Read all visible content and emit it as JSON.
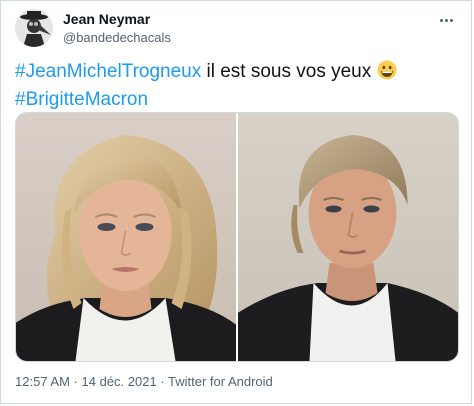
{
  "user": {
    "display_name": "Jean Neymar",
    "handle": "@bandedechacals"
  },
  "tweet": {
    "hashtag_1": "#JeanMichelTrogneux",
    "text_1": " il est sous vos yeux ",
    "emoji": "grinning-face-emoji",
    "hashtag_2": "#BrigitteMacron"
  },
  "media": {
    "photo_left": "photo-woman-blonde-hair",
    "photo_right": "photo-man-blond-hair"
  },
  "meta": {
    "time": "12:57 AM",
    "separator_1": " · ",
    "date": "14 déc. 2021",
    "separator_2": " · ",
    "source": "Twitter for Android"
  },
  "colors": {
    "link": "#1d9bf0",
    "secondary_text": "#536471",
    "border": "#cfd9de"
  }
}
